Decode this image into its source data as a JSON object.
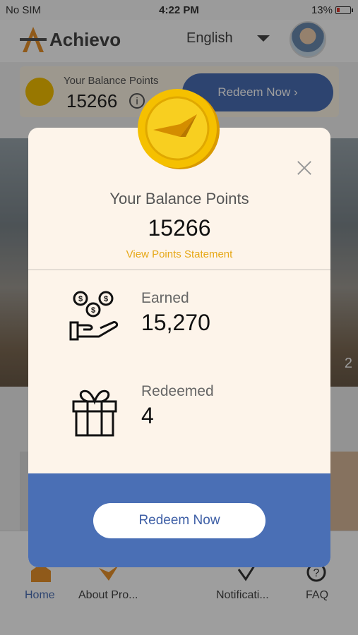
{
  "status_bar": {
    "carrier": "No SIM",
    "time": "4:22 PM",
    "battery": "13%"
  },
  "header": {
    "app_name": "Achievo",
    "language": "English"
  },
  "balance_bar": {
    "label": "Your Balance Points",
    "value": "15266",
    "info": "i",
    "redeem_label": "Redeem Now ›"
  },
  "banner": {
    "page_indicator": "2"
  },
  "tabs": [
    {
      "label": "Home"
    },
    {
      "label": "About Pro..."
    },
    {
      "label": "Notificati..."
    },
    {
      "label": "FAQ"
    }
  ],
  "modal": {
    "title": "Your Balance Points",
    "balance": "15266",
    "statement_link": "View Points Statement",
    "earned_label": "Earned",
    "earned_value": "15,270",
    "redeemed_label": "Redeemed",
    "redeemed_value": "4",
    "redeem_button": "Redeem Now"
  },
  "colors": {
    "accent": "#4a6fb5",
    "coin": "#f5c000",
    "link": "#e6a817",
    "modal_bg": "#fdf4ea"
  }
}
